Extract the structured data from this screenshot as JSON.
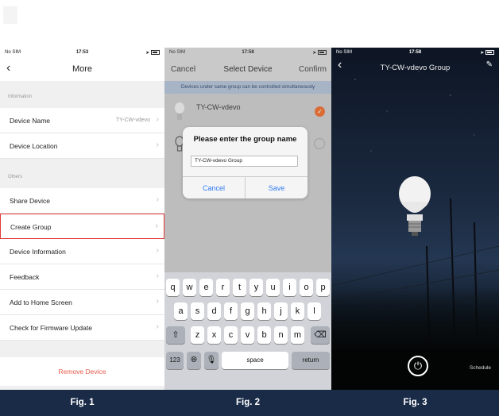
{
  "fig1": {
    "status": {
      "carrier": "No SIM",
      "time": "17:53"
    },
    "nav_title": "More",
    "sections": {
      "information": "Information",
      "others": "Others"
    },
    "rows": [
      {
        "label": "Device Name",
        "value": "TY-CW-vdevo"
      },
      {
        "label": "Device Location",
        "value": ""
      },
      {
        "label": "Share Device",
        "value": ""
      },
      {
        "label": "Create Group",
        "value": ""
      },
      {
        "label": "Device Information",
        "value": ""
      },
      {
        "label": "Feedback",
        "value": ""
      },
      {
        "label": "Add to Home Screen",
        "value": ""
      },
      {
        "label": "Check for Firmware Update",
        "value": ""
      }
    ],
    "remove_label": "Remove Device",
    "caption": "Fig. 1"
  },
  "fig2": {
    "status": {
      "carrier": "No SIM",
      "time": "17:58"
    },
    "cancel_label": "Cancel",
    "title": "Select Device",
    "confirm_label": "Confirm",
    "banner": "Devices under same group can be controlled simultaneously",
    "devices": [
      {
        "name": "TY-CW-vdevo",
        "selected": true
      },
      {
        "name": "",
        "selected": false
      }
    ],
    "dialog": {
      "title": "Please enter the group name",
      "input_value": "TY-CW-vdevo Group",
      "cancel": "Cancel",
      "save": "Save"
    },
    "keyboard": {
      "row1": [
        "q",
        "w",
        "e",
        "r",
        "t",
        "y",
        "u",
        "i",
        "o",
        "p"
      ],
      "row2": [
        "a",
        "s",
        "d",
        "f",
        "g",
        "h",
        "j",
        "k",
        "l"
      ],
      "row3": [
        "z",
        "x",
        "c",
        "v",
        "b",
        "n",
        "m"
      ],
      "numbers": "123",
      "space": "space",
      "return": "return"
    },
    "caption": "Fig. 2"
  },
  "fig3": {
    "status": {
      "carrier": "No SIM",
      "time": "17:58"
    },
    "title": "TY-CW-vdevo Group",
    "schedule_label": "Schedule",
    "caption": "Fig. 3"
  },
  "colors": {
    "accent_orange": "#e8743a",
    "remove_red": "#e65b4a",
    "highlight_red": "#e23a3a",
    "footer_navy": "#1a2b48",
    "ios_blue": "#2f7bf5"
  }
}
